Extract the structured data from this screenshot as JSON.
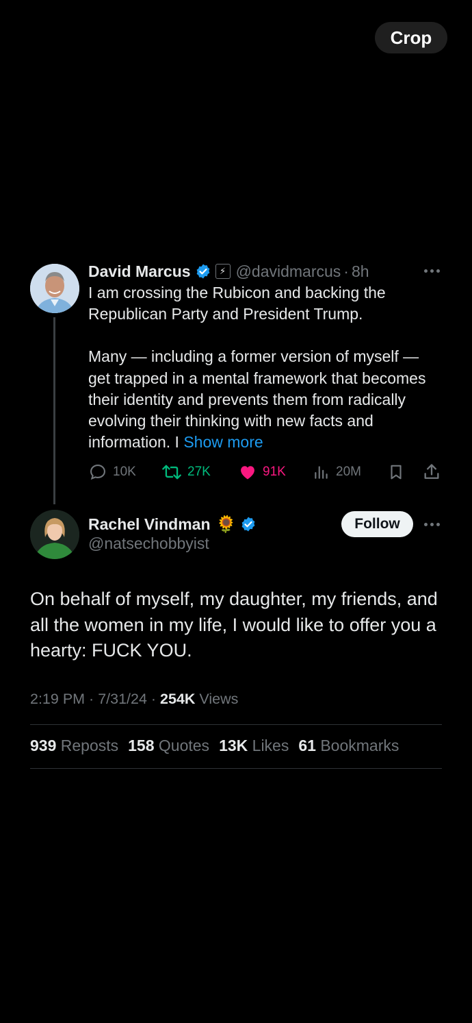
{
  "toolbar": {
    "crop_label": "Crop"
  },
  "parent_tweet": {
    "author_name": "David Marcus",
    "handle": "@davidmarcus",
    "separator": "·",
    "time": "8h",
    "affiliate_badge": "⚡",
    "paragraph1": "I am crossing the Rubicon and backing the Republican Party and President Trump.",
    "paragraph2": "Many — including a former version of myself — get trapped in a mental framework that becomes their identity and prevents them from radically evolving their thinking with new facts and information. I",
    "show_more": "Show more",
    "actions": {
      "replies": "10K",
      "reposts": "27K",
      "likes": "91K",
      "views": "20M"
    }
  },
  "quoted_tweet": {
    "author_name": "Rachel Vindman",
    "emoji": "🌻",
    "handle": "@natsechobbyist",
    "follow_label": "Follow",
    "text": "On behalf of myself, my daughter, my friends, and all the women in my life, I would like to offer you a hearty: FUCK YOU.",
    "meta": {
      "time": "2:19 PM",
      "date": "7/31/24",
      "sep1": " · ",
      "sep2": " · ",
      "views_count": "254K",
      "views_label": " Views"
    },
    "stats": {
      "reposts_count": "939",
      "reposts_label": "Reposts",
      "quotes_count": "158",
      "quotes_label": "Quotes",
      "likes_count": "13K",
      "likes_label": "Likes",
      "bookmarks_count": "61",
      "bookmarks_label": "Bookmarks"
    }
  },
  "colors": {
    "background": "#000000",
    "accent_blue": "#1d9bf0",
    "repost_green": "#00ba7c",
    "like_pink": "#f91880",
    "muted_gray": "#71767b"
  },
  "icons": [
    "reply-icon",
    "repost-icon",
    "heart-icon",
    "views-icon",
    "bookmark-icon",
    "share-icon",
    "verified-badge-icon",
    "more-icon"
  ]
}
